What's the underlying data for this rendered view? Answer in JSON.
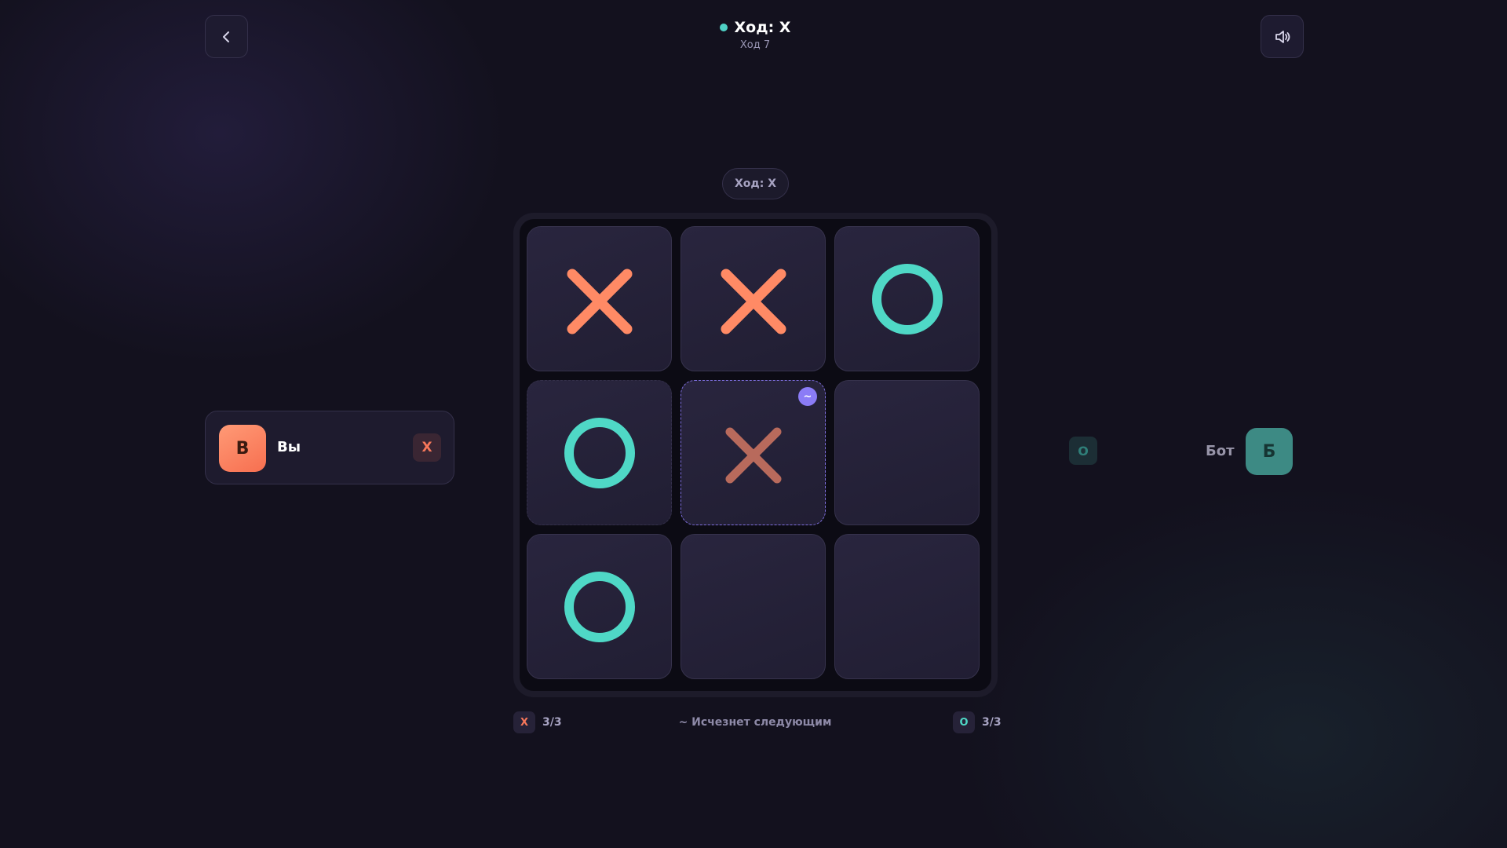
{
  "header": {
    "turn_label": "Ход: X",
    "move_label": "Ход 7",
    "indicator_color": "#4fd1c5"
  },
  "controls": {
    "back_icon": "chevron-left-icon",
    "sound_icon": "speaker-icon"
  },
  "turn_pill": "Ход: X",
  "board": {
    "cells": [
      [
        "X",
        "X",
        "O"
      ],
      [
        "O",
        "X",
        ""
      ],
      [
        "O",
        "",
        ""
      ]
    ],
    "fading_next": {
      "row": 1,
      "col": 1,
      "badge": "~"
    },
    "colors": {
      "x": "#ff8a65",
      "o": "#4fd8c6",
      "fading_x": "#b86a5c",
      "highlight": "#8b7cf6"
    }
  },
  "player": {
    "avatar_letter": "В",
    "name": "Вы",
    "mark": "X"
  },
  "bot": {
    "mark": "O",
    "name": "Бот",
    "avatar_letter": "Б"
  },
  "counters": {
    "x": {
      "mark": "X",
      "value": "3/3"
    },
    "o": {
      "mark": "O",
      "value": "3/3"
    },
    "note": "~ Исчезнет следующим"
  }
}
